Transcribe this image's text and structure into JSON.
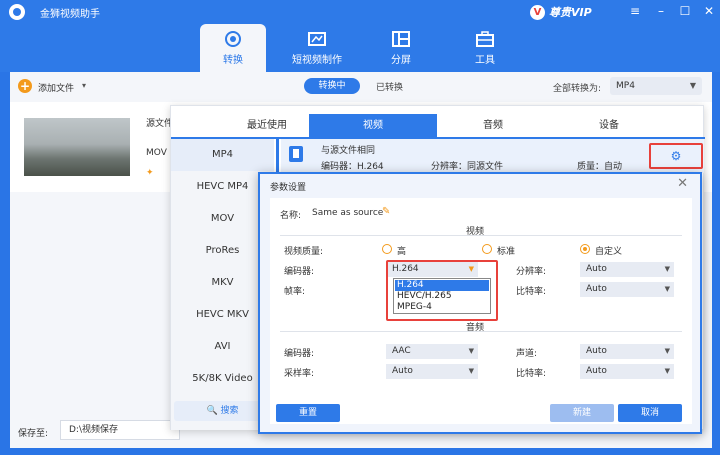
{
  "app": {
    "title": "金狮视频助手",
    "vip_label": "尊贵VIP"
  },
  "window": {
    "menu": "≡",
    "minimize": "–",
    "maximize": "☐",
    "close": "✕"
  },
  "nav": [
    {
      "label": "转换",
      "icon": "convert-icon",
      "active": true
    },
    {
      "label": "短视频制作",
      "icon": "short-video-icon",
      "active": false
    },
    {
      "label": "分屏",
      "icon": "split-screen-icon",
      "active": false
    },
    {
      "label": "工具",
      "icon": "toolbox-icon",
      "active": false
    }
  ],
  "toolbar": {
    "add_file": "添加文件",
    "tab_converting": "转换中",
    "tab_converted": "已转换",
    "convert_all_label": "全部转换为:",
    "convert_all_value": "MP4"
  },
  "file": {
    "source_label": "源文件",
    "format": "MOV"
  },
  "save": {
    "label": "保存至:",
    "path": "D:\\视频保存"
  },
  "format_panel": {
    "tabs": [
      "最近使用",
      "视频",
      "音频",
      "设备"
    ],
    "active_tab": "视频",
    "formats": [
      "MP4",
      "HEVC MP4",
      "MOV",
      "ProRes",
      "MKV",
      "HEVC MKV",
      "AVI",
      "5K/8K Video"
    ],
    "active_format": "MP4",
    "search_label": "搜索",
    "preset": {
      "name": "与源文件相同",
      "encoder": "编码器：H.264",
      "resolution": "分辨率：同源文件",
      "quality": "质量：自动"
    }
  },
  "dialog": {
    "title": "参数设置",
    "name_label": "名称:",
    "name_value": "Same as source",
    "video_section": "视频",
    "quality_label": "视频质量:",
    "quality_options": [
      "高",
      "标准",
      "自定义"
    ],
    "quality_selected": "自定义",
    "encoder_label": "编码器:",
    "encoder_value": "H.264",
    "encoder_options": [
      "H.264",
      "HEVC/H.265",
      "MPEG-4"
    ],
    "resolution_label": "分辨率:",
    "resolution_value": "Auto",
    "framerate_label": "帧率:",
    "bitrate_label": "比特率:",
    "bitrate_value": "Auto",
    "audio_section": "音频",
    "audio_encoder_label": "编码器:",
    "audio_encoder_value": "AAC",
    "channel_label": "声道:",
    "channel_value": "Auto",
    "samplerate_label": "采样率:",
    "samplerate_value": "Auto",
    "audio_bitrate_label": "比特率:",
    "audio_bitrate_value": "Auto",
    "reset_button": "重置",
    "new_button": "新建",
    "cancel_button": "取消"
  },
  "colors": {
    "brand_blue": "#2e7ae8",
    "accent_orange": "#f39a1c",
    "highlight_red": "#e8413b"
  }
}
